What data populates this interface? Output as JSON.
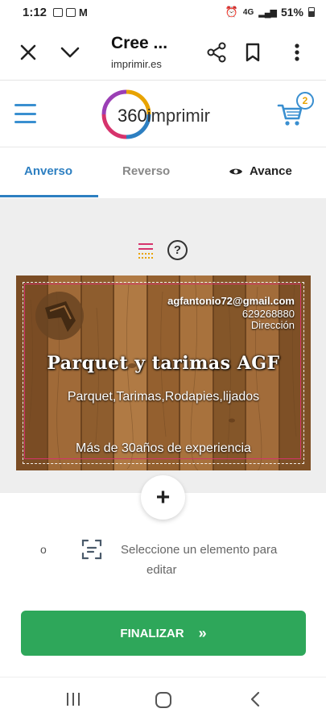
{
  "status_bar": {
    "time": "1:12",
    "signal": "4G",
    "battery": "51%"
  },
  "browser": {
    "title": "Cree ...",
    "url": "imprimir.es"
  },
  "site": {
    "logo_number": "360",
    "logo_name": "imprimir",
    "cart_count": "2"
  },
  "tabs": [
    {
      "label": "Anverso",
      "active": true
    },
    {
      "label": "Reverso",
      "active": false
    },
    {
      "label": "Avance",
      "active": false
    }
  ],
  "tools": {
    "help": "?"
  },
  "card": {
    "email": "agfantonio72@gmail.com",
    "phone": "629268880",
    "address": "Dirección",
    "title": "Parquet y tarimas AGF",
    "subtitle": "Parquet,Tarimas,Rodapies,lijados",
    "experience": "Más de 30años de experiencia"
  },
  "add_button": "+",
  "hint": {
    "or": "o",
    "line1": "Seleccione un elemento para",
    "line2": "editar"
  },
  "finalize": {
    "label": "FINALIZAR",
    "icon": "»"
  },
  "colors": {
    "accent": "#2d7fc1",
    "finalize": "#2ea75a",
    "card_border": "#d6336c"
  }
}
